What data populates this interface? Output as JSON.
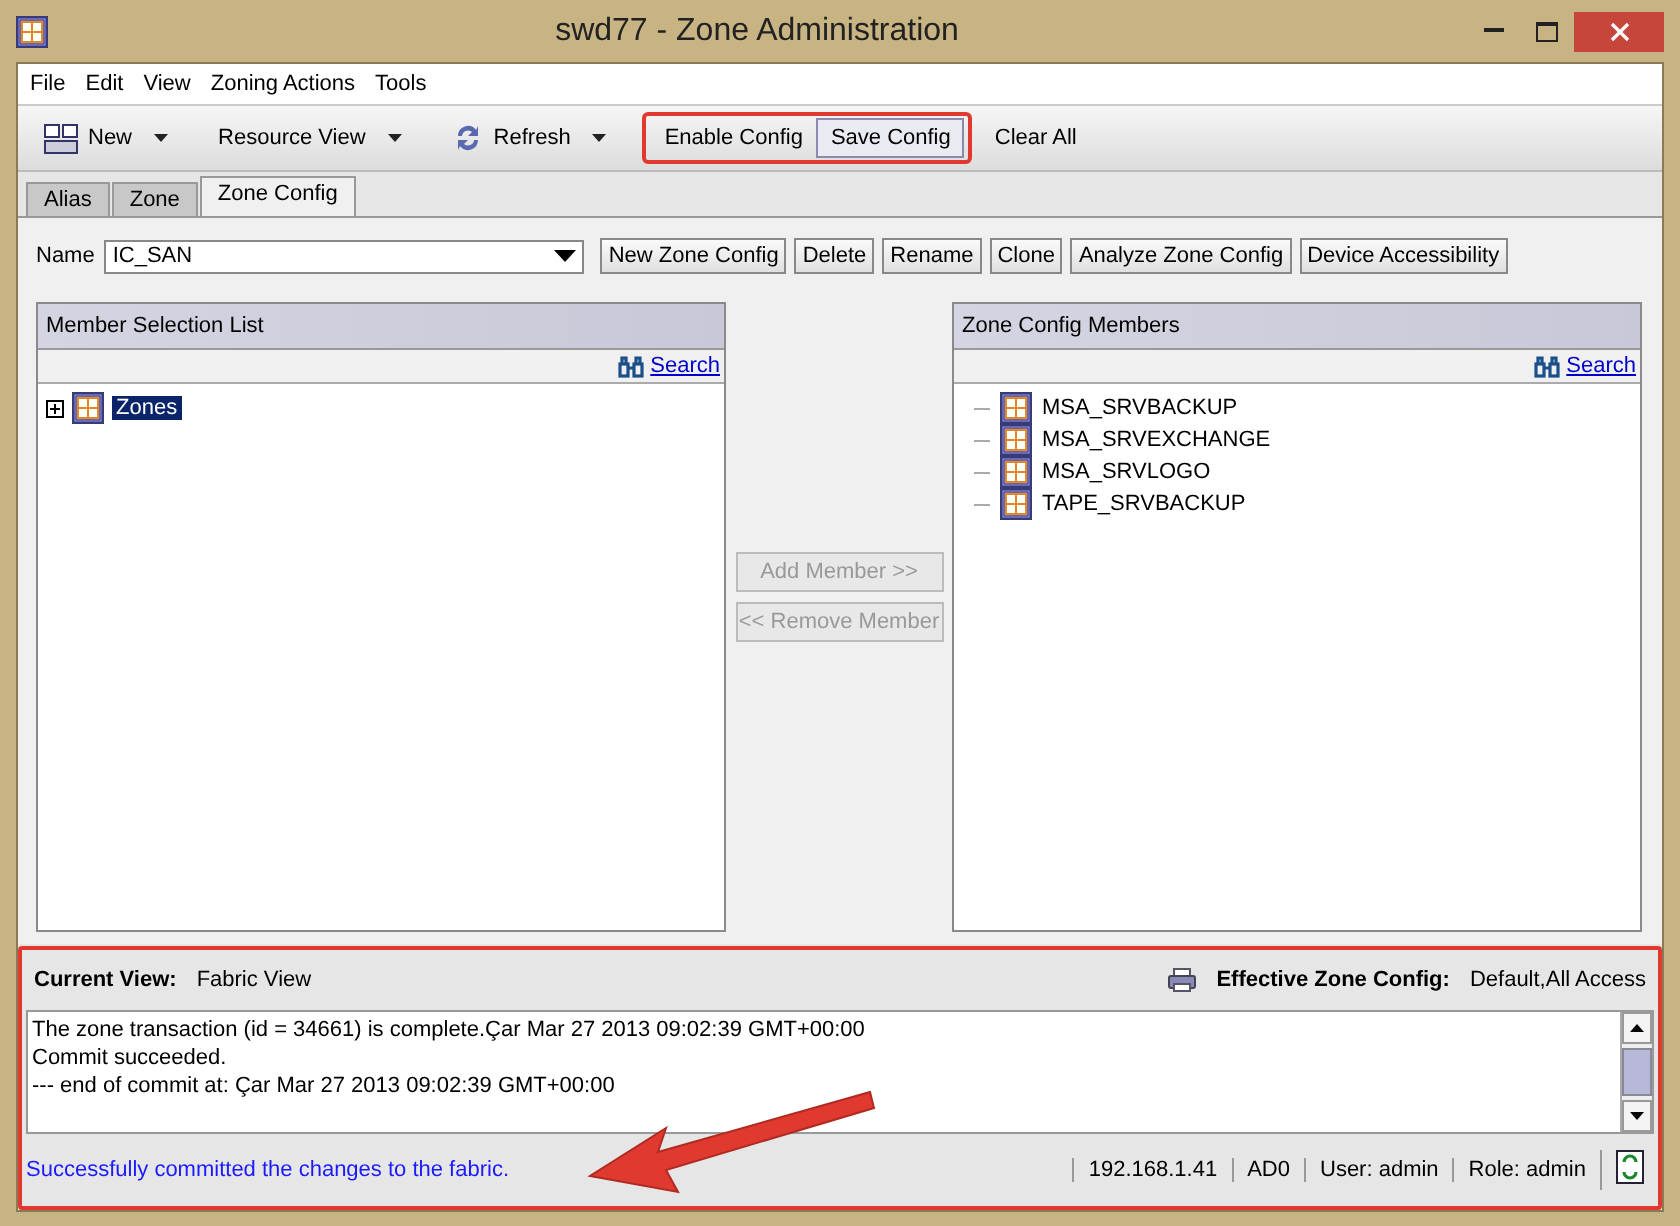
{
  "window": {
    "title": "swd77 - Zone Administration"
  },
  "menu": [
    {
      "label": "File"
    },
    {
      "label": "Edit"
    },
    {
      "label": "View"
    },
    {
      "label": "Zoning Actions"
    },
    {
      "label": "Tools"
    }
  ],
  "toolbar": [
    {
      "label": "New",
      "kind": "dropdown"
    },
    {
      "label": "Resource View",
      "kind": "dropdown"
    },
    {
      "label": "Refresh",
      "kind": "dropdown"
    },
    {
      "label": "Enable Config",
      "kind": "plain"
    },
    {
      "label": "Save Config",
      "kind": "raised"
    },
    {
      "label": "Clear All",
      "kind": "plain"
    }
  ],
  "tabs": [
    {
      "label": "Alias",
      "selected": false
    },
    {
      "label": "Zone",
      "selected": false
    },
    {
      "label": "Zone Config",
      "selected": true
    }
  ],
  "name_field": {
    "label": "Name",
    "value": "IC_SAN"
  },
  "config_buttons": [
    "New Zone Config",
    "Delete",
    "Rename",
    "Clone",
    "Analyze Zone Config",
    "Device Accessibility"
  ],
  "member_selection": {
    "title": "Member Selection List",
    "search": "Search",
    "tree": [
      {
        "label": "Zones",
        "expanded": false,
        "selected": true
      }
    ]
  },
  "transfer_buttons": [
    {
      "label": "Add Member >>",
      "disabled": true
    },
    {
      "label": "<< Remove Member",
      "disabled": true
    }
  ],
  "config_members": {
    "title": "Zone Config Members",
    "search": "Search",
    "items": [
      "MSA_SRVBACKUP",
      "MSA_SRVEXCHANGE",
      "MSA_SRVLOGO",
      "TAPE_SRVBACKUP"
    ]
  },
  "view_bar": {
    "current_view_label": "Current View:",
    "current_view": "Fabric View",
    "effective_label": "Effective Zone Config:",
    "effective": "Default,All Access"
  },
  "log": [
    "The zone transaction (id = 34661) is complete.Çar Mar 27 2013 09:02:39 GMT+00:00",
    "Commit succeeded.",
    "--- end of commit at: Çar Mar 27 2013 09:02:39 GMT+00:00"
  ],
  "status_bar": {
    "message": "Successfully committed the changes to the fabric.",
    "fields": [
      "192.168.1.41",
      "AD0",
      "User: admin",
      "Role: admin"
    ]
  }
}
